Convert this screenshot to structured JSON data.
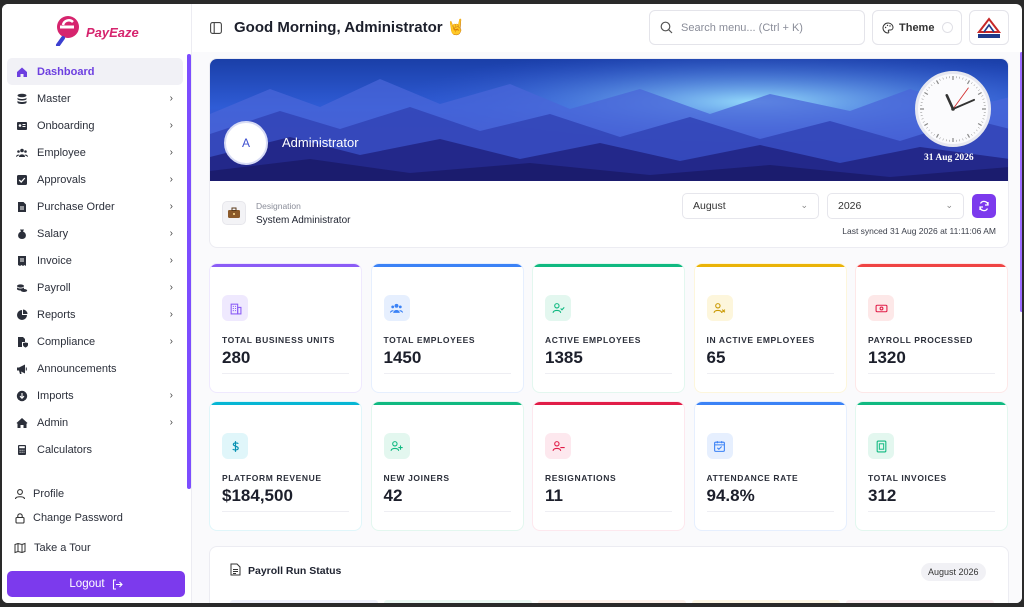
{
  "app": {
    "logo_text": "PayEaze"
  },
  "sidebar": {
    "items": [
      {
        "label": "Dashboard",
        "icon": "home-icon",
        "active": true,
        "chevron": false
      },
      {
        "label": "Master",
        "icon": "database-icon",
        "chevron": true
      },
      {
        "label": "Onboarding",
        "icon": "id-card-icon",
        "chevron": true
      },
      {
        "label": "Employee",
        "icon": "users-icon",
        "chevron": true
      },
      {
        "label": "Approvals",
        "icon": "check-square-icon",
        "chevron": true
      },
      {
        "label": "Purchase Order",
        "icon": "file-icon",
        "chevron": true
      },
      {
        "label": "Salary",
        "icon": "money-bag-icon",
        "chevron": true
      },
      {
        "label": "Invoice",
        "icon": "invoice-icon",
        "chevron": true
      },
      {
        "label": "Payroll",
        "icon": "coins-icon",
        "chevron": true
      },
      {
        "label": "Reports",
        "icon": "pie-chart-icon",
        "chevron": true
      },
      {
        "label": "Compliance",
        "icon": "file-shield-icon",
        "chevron": true
      },
      {
        "label": "Announcements",
        "icon": "megaphone-icon",
        "chevron": false
      },
      {
        "label": "Imports",
        "icon": "download-icon",
        "chevron": true
      },
      {
        "label": "Admin",
        "icon": "admin-home-icon",
        "chevron": true
      },
      {
        "label": "Calculators",
        "icon": "calculator-icon",
        "chevron": false
      }
    ],
    "profile_label": "Profile",
    "change_password_label": "Change Password",
    "tour_label": "Take a Tour",
    "logout_label": "Logout"
  },
  "header": {
    "greeting": "Good Morning, Administrator",
    "greeting_emoji": "🤘",
    "search_placeholder": "Search menu... (Ctrl + K)",
    "theme_label": "Theme"
  },
  "profile": {
    "avatar_letter": "A",
    "name": "Administrator",
    "clock_date": "31 Aug 2026",
    "clock_time": {
      "hour": 11,
      "minute": 11,
      "second": 6
    },
    "designation_label": "Designation",
    "designation": "System Administrator",
    "month_selected": "August",
    "year_selected": "2026",
    "last_synced": "Last synced 31 Aug 2026 at 11:11:06 AM"
  },
  "stats": [
    {
      "label": "TOTAL BUSINESS UNITS",
      "value": "280",
      "icon": "building-icon",
      "accent": "#8b5cf6",
      "tint": "#efe9fe",
      "iconColor": "#8b5cf6"
    },
    {
      "label": "TOTAL EMPLOYEES",
      "value": "1450",
      "icon": "users-icon",
      "accent": "#3b82f6",
      "tint": "#e6effe",
      "iconColor": "#3b82f6"
    },
    {
      "label": "ACTIVE EMPLOYEES",
      "value": "1385",
      "icon": "user-check-icon",
      "accent": "#10b981",
      "tint": "#e3f7ef",
      "iconColor": "#10b981"
    },
    {
      "label": "IN ACTIVE EMPLOYEES",
      "value": "65",
      "icon": "user-x-icon",
      "accent": "#eab308",
      "tint": "#fdf6dc",
      "iconColor": "#ca9a04"
    },
    {
      "label": "PAYROLL PROCESSED",
      "value": "1320",
      "icon": "banknote-icon",
      "accent": "#ef4444",
      "tint": "#fde8e8",
      "iconColor": "#e11d48"
    },
    {
      "label": "PLATFORM REVENUE",
      "value": "$184,500",
      "icon": "dollar-icon",
      "accent": "#06b6d4",
      "tint": "#e0f6fa",
      "iconColor": "#0891b2"
    },
    {
      "label": "NEW JOINERS",
      "value": "42",
      "icon": "user-plus-icon",
      "accent": "#10b981",
      "tint": "#e3f7ef",
      "iconColor": "#10b981"
    },
    {
      "label": "RESIGNATIONS",
      "value": "11",
      "icon": "user-minus-icon",
      "accent": "#e11d48",
      "tint": "#fde8ee",
      "iconColor": "#e11d48"
    },
    {
      "label": "ATTENDANCE RATE",
      "value": "94.8%",
      "icon": "calendar-check-icon",
      "accent": "#3b82f6",
      "tint": "#e6effe",
      "iconColor": "#3b82f6"
    },
    {
      "label": "TOTAL INVOICES",
      "value": "312",
      "icon": "receipt-icon",
      "accent": "#10b981",
      "tint": "#e3f7ef",
      "iconColor": "#10b981"
    }
  ],
  "payroll_run": {
    "title": "Payroll Run Status",
    "period": "August 2026"
  },
  "colors": {
    "primary": "#7c3aed",
    "active_text": "#6d3fe0"
  }
}
